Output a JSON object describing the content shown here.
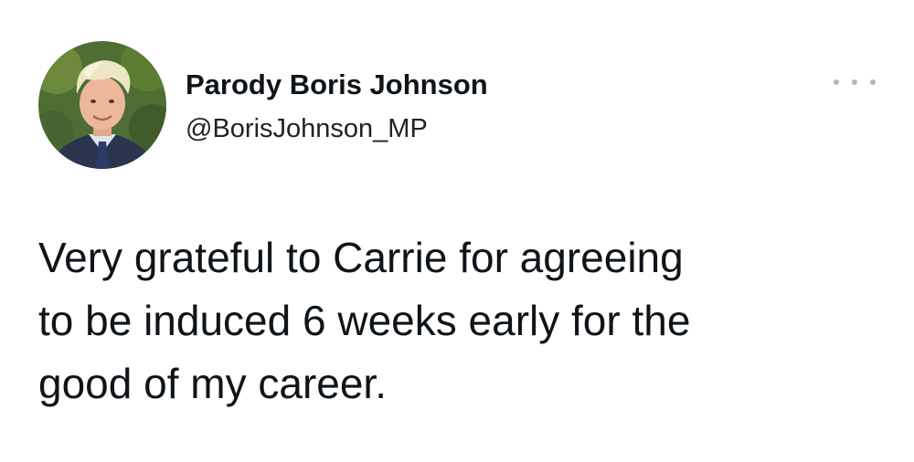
{
  "tweet": {
    "author_name": "Parody Boris Johnson",
    "author_handle": "@BorisJohnson_MP",
    "avatar_icon": "profile-photo",
    "more_icon": "more-options-icon",
    "text_lines": [
      "Very grateful to Carrie for agreeing",
      "to be induced 6 weeks early for the",
      "good of my career."
    ]
  }
}
